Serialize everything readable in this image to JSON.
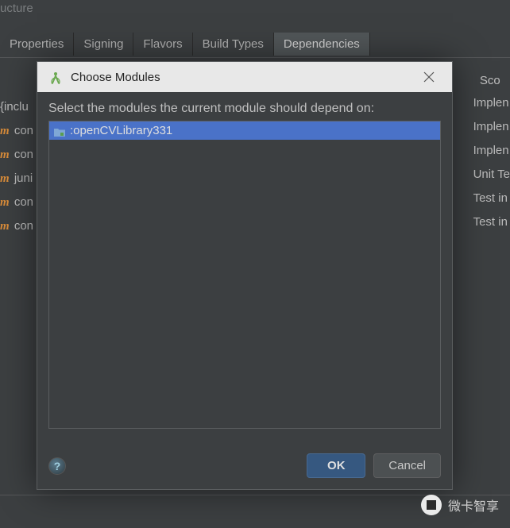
{
  "background": {
    "window_title": "ucture",
    "tabs": [
      "Properties",
      "Signing",
      "Flavors",
      "Build Types",
      "Dependencies"
    ],
    "active_tab": 4,
    "left_rows": [
      {
        "prefix": "",
        "text": "{inclu"
      },
      {
        "prefix": "m",
        "text": " con"
      },
      {
        "prefix": "m",
        "text": " con"
      },
      {
        "prefix": "m",
        "text": " juni"
      },
      {
        "prefix": "m",
        "text": " con"
      },
      {
        "prefix": "m",
        "text": " con"
      }
    ],
    "right_header": "Sco",
    "right_rows": [
      "Implen",
      "Implen",
      "Implen",
      "Unit Te",
      "Test in",
      "Test in"
    ]
  },
  "dialog": {
    "title": "Choose Modules",
    "prompt": "Select the modules the current module should depend on:",
    "items": [
      {
        "label": ":openCVLibrary331",
        "selected": true
      }
    ],
    "ok_label": "OK",
    "cancel_label": "Cancel",
    "help_symbol": "?"
  },
  "watermark": {
    "text": "微卡智享"
  }
}
